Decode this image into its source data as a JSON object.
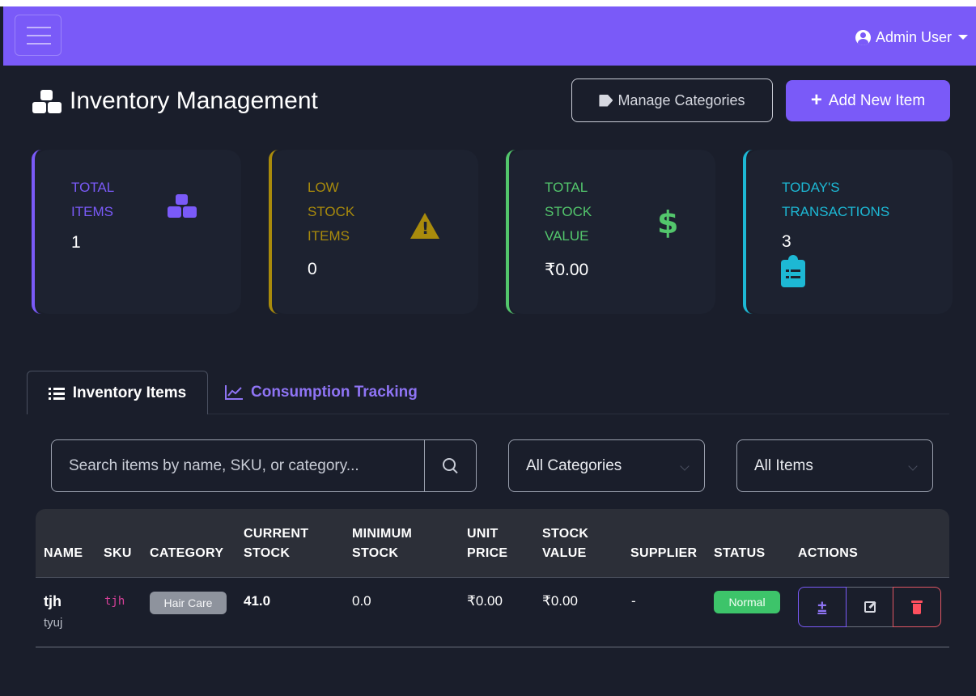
{
  "navbar": {
    "user_label": "Admin User",
    "brand_color": "#7a5af8"
  },
  "header": {
    "title": "Inventory Management",
    "manage_categories_label": "Manage Categories",
    "add_item_label": "Add New Item"
  },
  "stats": [
    {
      "label": "TOTAL ITEMS",
      "value": "1",
      "color": "#7a5af8",
      "icon": "boxes-icon"
    },
    {
      "label": "LOW STOCK ITEMS",
      "value": "0",
      "color": "#a98b0c",
      "icon": "warning-icon"
    },
    {
      "label": "TOTAL STOCK VALUE",
      "value": "₹0.00",
      "color": "#53c66c",
      "icon": "dollar-icon"
    },
    {
      "label": "TODAY'S TRANSACTIONS",
      "value": "3",
      "color": "#1db8d4",
      "icon": "clipboard-list-icon"
    }
  ],
  "tabs": [
    {
      "label": "Inventory Items",
      "active": true,
      "icon": "list-icon"
    },
    {
      "label": "Consumption Tracking",
      "active": false,
      "icon": "chart-line-icon"
    }
  ],
  "filters": {
    "search_placeholder": "Search items by name, SKU, or category...",
    "category_selected": "All Categories",
    "items_selected": "All Items"
  },
  "table": {
    "headers": {
      "name": "NAME",
      "sku": "SKU",
      "category": "CATEGORY",
      "current_stock": [
        "CURRENT",
        "STOCK"
      ],
      "minimum_stock": [
        "MINIMUM",
        "STOCK"
      ],
      "unit_price": [
        "UNIT",
        "PRICE"
      ],
      "stock_value": [
        "STOCK",
        "VALUE"
      ],
      "supplier": "SUPPLIER",
      "status": "STATUS",
      "actions": "ACTIONS"
    },
    "rows": [
      {
        "name": "tjh",
        "description": "tyuj",
        "sku": "tjh",
        "category": "Hair Care",
        "current_stock": "41.0",
        "minimum_stock": "0.0",
        "unit_price": "₹0.00",
        "stock_value": "₹0.00",
        "supplier": "-",
        "status": "Normal",
        "adjust_label": "±"
      }
    ]
  }
}
